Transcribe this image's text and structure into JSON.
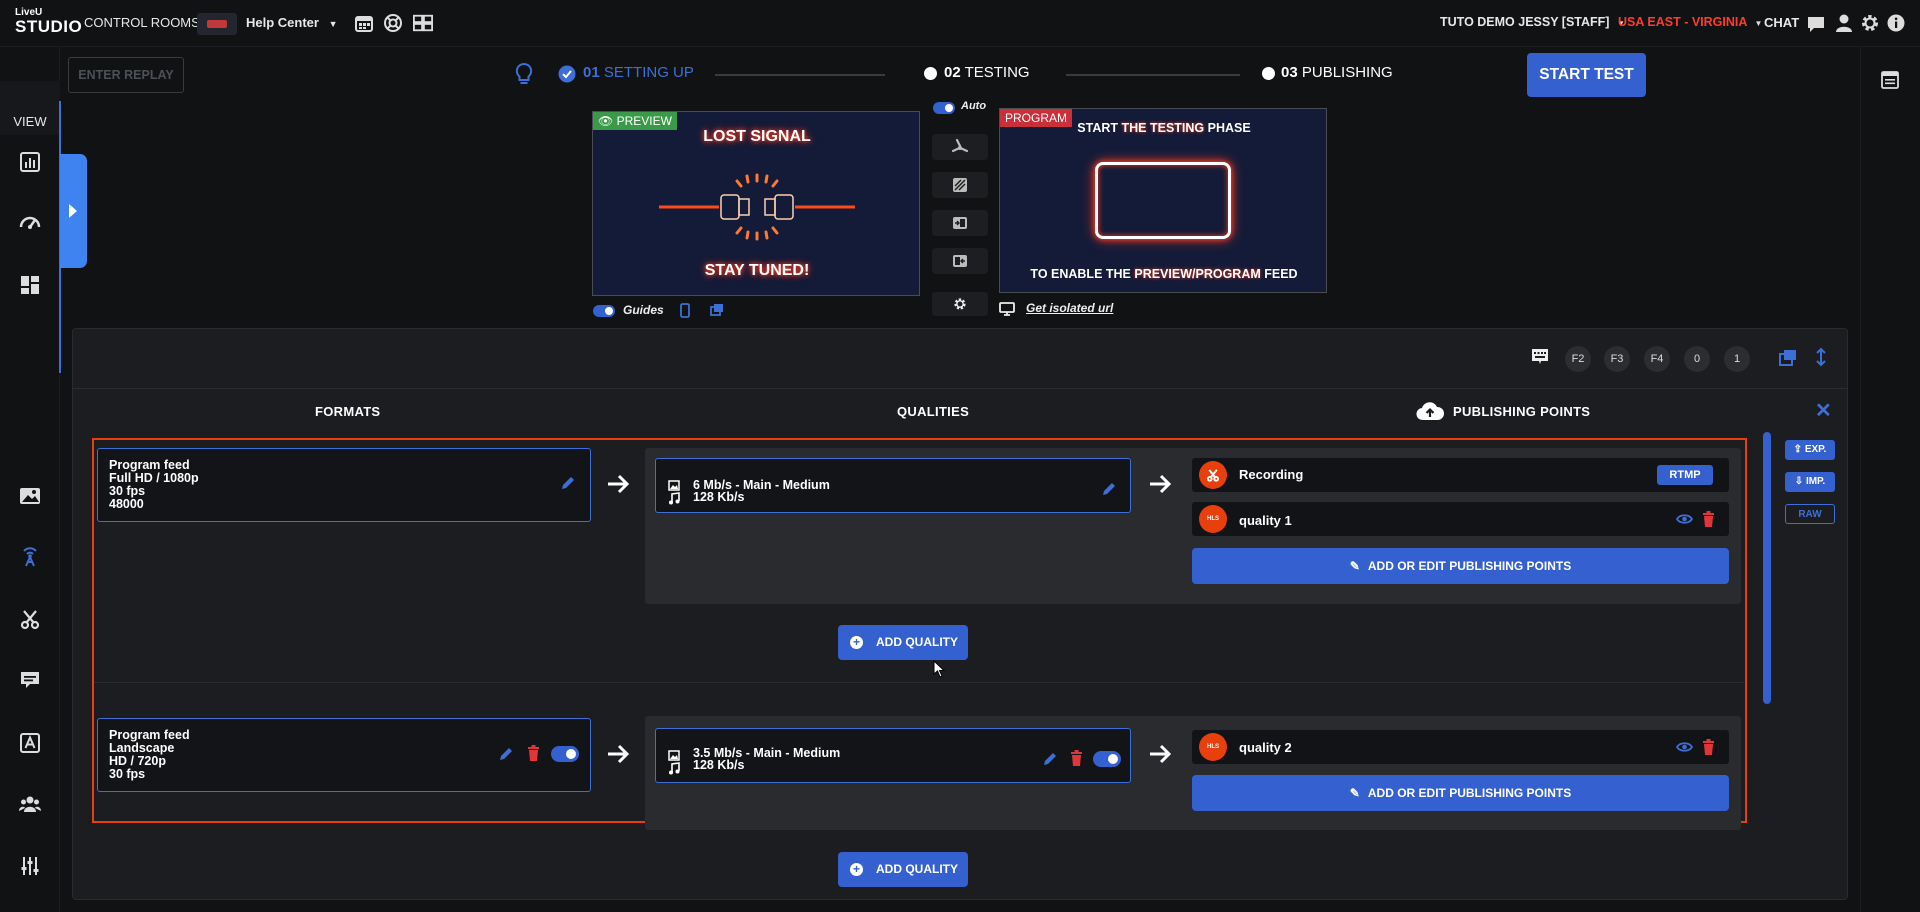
{
  "topbar": {
    "logo_line1": "LiveU",
    "logo_line2": "STUDIO",
    "control_rooms": "CONTROL ROOMS",
    "help_center": "Help Center",
    "user": "TUTO DEMO JESSY [STAFF]",
    "region": "USA EAST - VIRGINIA",
    "chat": "CHAT"
  },
  "sidebar": {
    "view_label": "VIEW"
  },
  "toolbar": {
    "enter_replay": "ENTER REPLAY",
    "start_test": "START TEST"
  },
  "stepper": [
    {
      "num": "01",
      "label": "SETTING UP",
      "state": "done"
    },
    {
      "num": "02",
      "label": "TESTING",
      "state": "pending"
    },
    {
      "num": "03",
      "label": "PUBLISHING",
      "state": "pending"
    }
  ],
  "preview": {
    "badge": "PREVIEW",
    "line1": "LOST SIGNAL",
    "line2": "STAY TUNED!",
    "guides_label": "Guides"
  },
  "program": {
    "badge": "PROGRAM",
    "top_a": "START ",
    "top_b": "THE TESTING",
    "top_c": " PHASE",
    "bot_a": "TO ENABLE THE ",
    "bot_b": "PREVIEW/PROGRAM",
    "bot_c": " FEED",
    "auto_label": "Auto",
    "isolated_url": "Get isolated url"
  },
  "panel": {
    "fkeys": [
      "F2",
      "F3",
      "F4",
      "0",
      "1"
    ],
    "headers": {
      "formats": "FORMATS",
      "qualities": "QUALITIES",
      "publishing": "PUBLISHING POINTS"
    },
    "side_buttons": {
      "exp": "EXP.",
      "imp": "IMP.",
      "raw": "RAW"
    },
    "add_quality": "ADD QUALITY",
    "add_edit_pp": "ADD OR EDIT PUBLISHING POINTS",
    "formats": [
      {
        "lines": [
          "Program feed",
          "Full HD / 1080p",
          "30 fps",
          "48000"
        ],
        "quality": {
          "video": "6 Mb/s  -  Main  -  Medium",
          "audio": "128 Kb/s"
        },
        "points": [
          {
            "name": "Recording",
            "tag": "RTMP",
            "icon": "scissors-icon"
          },
          {
            "name": "quality 1",
            "tag": "HLS",
            "icon": "hls-icon"
          }
        ]
      },
      {
        "lines": [
          "Program feed",
          "Landscape",
          "HD / 720p",
          "30 fps"
        ],
        "quality": {
          "video": "3.5 Mb/s  -  Main  -  Medium",
          "audio": "128 Kb/s"
        },
        "points": [
          {
            "name": "quality 2",
            "tag": "HLS",
            "icon": "hls-icon"
          }
        ]
      }
    ]
  },
  "colors": {
    "accent": "#3560cf",
    "highlight": "#e8400c",
    "region": "#ff3b30",
    "preview_badge": "#3a9a4a",
    "program_badge": "#c9303a"
  }
}
